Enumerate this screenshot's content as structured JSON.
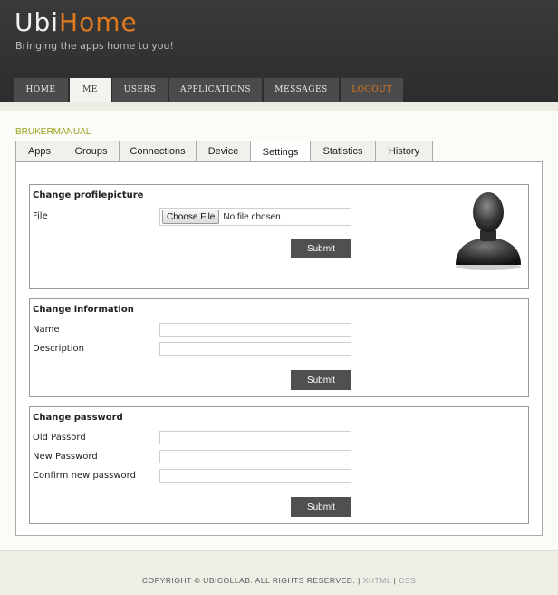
{
  "header": {
    "logo_part1": "Ubi",
    "logo_part2": "Home",
    "tagline": "Bringing the apps home to you!"
  },
  "nav": {
    "items": [
      {
        "label": "HOME"
      },
      {
        "label": "ME"
      },
      {
        "label": "USERS"
      },
      {
        "label": "APPLICATIONS"
      },
      {
        "label": "MESSAGES"
      },
      {
        "label": "LOGOUT"
      }
    ],
    "active": "ME"
  },
  "breadcrumb": "BRUKERMANUAL",
  "subtabs": {
    "items": [
      {
        "label": "Apps"
      },
      {
        "label": "Groups"
      },
      {
        "label": "Connections"
      },
      {
        "label": "Device"
      },
      {
        "label": "Settings"
      },
      {
        "label": "Statistics"
      },
      {
        "label": "History"
      }
    ],
    "active": "Settings"
  },
  "profile_picture": {
    "title": "Change profilepicture",
    "file_label": "File",
    "choose_button": "Choose File",
    "file_status": "No file chosen",
    "submit": "Submit",
    "avatar_icon": "user-silhouette-icon"
  },
  "information": {
    "title": "Change information",
    "name_label": "Name",
    "name_value": "",
    "description_label": "Description",
    "description_value": "",
    "submit": "Submit"
  },
  "password": {
    "title": "Change password",
    "old_label": "Old Passord",
    "new_label": "New Password",
    "confirm_label": "Confirm new password",
    "submit": "Submit"
  },
  "footer": {
    "copyright": "COPYRIGHT © UBICOLLAB. ALL RIGHTS RESERVED.",
    "sep": "|",
    "xhtml": "XHTML",
    "css": "CSS"
  },
  "colors": {
    "accent": "#e07a1e",
    "header_bg": "#333333",
    "breadcrumb": "#9aa21a",
    "button_bg": "#505050"
  }
}
